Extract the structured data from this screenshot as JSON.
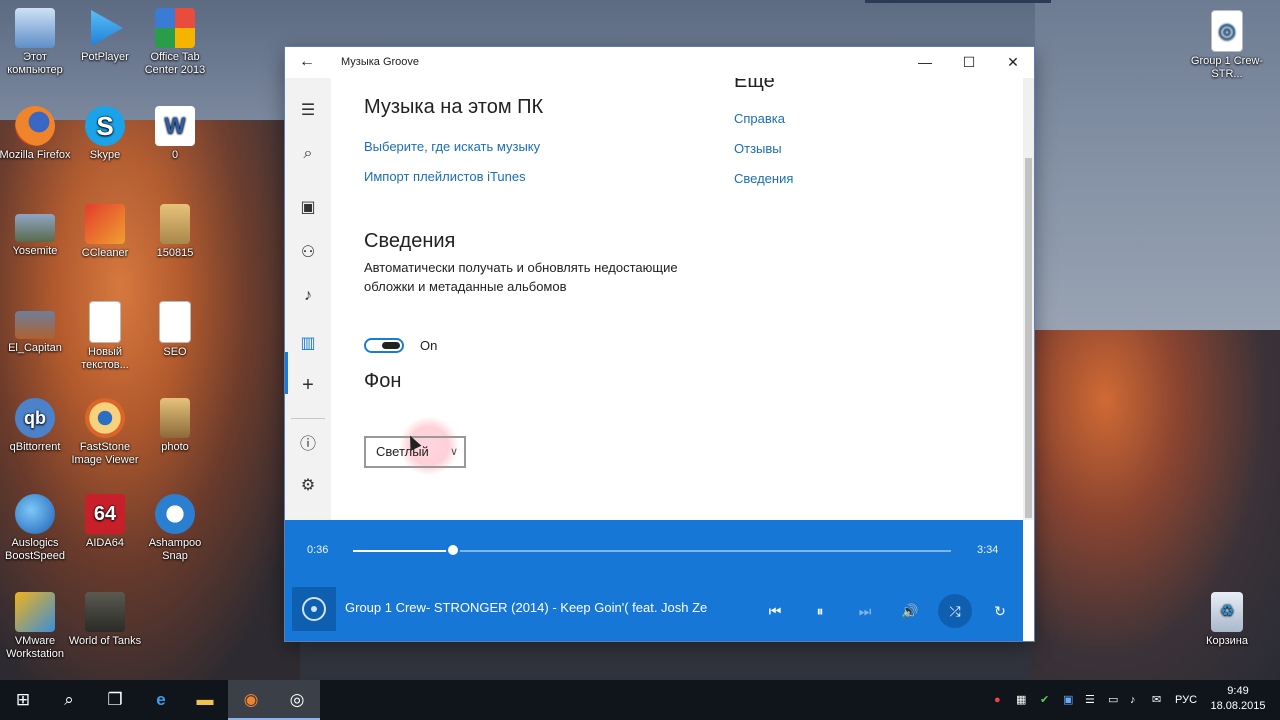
{
  "desktop": {
    "icons": [
      {
        "label": "Этот компьютер",
        "icon": "computer-icon"
      },
      {
        "label": "PotPlayer",
        "icon": "potplayer-icon"
      },
      {
        "label": "Office Tab Center 2013",
        "icon": "office-tab-icon"
      },
      {
        "label": "Mozilla Firefox",
        "icon": "firefox-icon"
      },
      {
        "label": "Skype",
        "icon": "skype-icon"
      },
      {
        "label": "0",
        "icon": "word-doc-icon"
      },
      {
        "label": "Yosemite",
        "icon": "image-icon"
      },
      {
        "label": "CCleaner",
        "icon": "ccleaner-icon"
      },
      {
        "label": "150815",
        "icon": "folder-icon"
      },
      {
        "label": "El_Capitan",
        "icon": "image-icon"
      },
      {
        "label": "Новый текстов...",
        "icon": "text-file-icon"
      },
      {
        "label": "SEO",
        "icon": "text-file-icon"
      },
      {
        "label": "qBittorrent",
        "icon": "qbittorrent-icon"
      },
      {
        "label": "FastStone Image Viewer",
        "icon": "faststone-icon"
      },
      {
        "label": "photo",
        "icon": "folder-icon"
      },
      {
        "label": "Auslogics BoostSpeed",
        "icon": "auslogics-icon"
      },
      {
        "label": "AIDA64",
        "icon": "aida64-icon"
      },
      {
        "label": "Ashampoo Snap",
        "icon": "ashampoo-icon"
      },
      {
        "label": "VMware Workstation",
        "icon": "vmware-icon"
      },
      {
        "label": "World of Tanks",
        "icon": "wot-icon"
      },
      {
        "label": "Group 1 Crew- STR...",
        "icon": "groove-file-icon"
      },
      {
        "label": "Корзина",
        "icon": "recycle-bin-icon"
      }
    ]
  },
  "window": {
    "title": "Музыка Groove",
    "back": "←",
    "minimize": "—",
    "maximize": "☐",
    "close": "✕"
  },
  "rail": {
    "hamburger": "☰",
    "search": "⌕",
    "albums": "▣",
    "artists": "⚇",
    "songs": "♪",
    "now_playing": "▥",
    "add": "+",
    "info": "ⓘ",
    "settings": "⚙"
  },
  "settings": {
    "music_heading": "Музыка на этом ПК",
    "choose_folders": "Выберите, где искать музыку",
    "import_itunes": "Импорт плейлистов iTunes",
    "info_heading": "Сведения",
    "info_desc_1": "Автоматически получать и обновлять недостающие",
    "info_desc_2": "обложки и метаданные альбомов",
    "toggle_state": "On",
    "background_heading": "Фон",
    "background_value": "Светлый",
    "more_heading": "Еще",
    "help": "Справка",
    "feedback": "Отзывы",
    "about": "Сведения"
  },
  "player": {
    "elapsed": "0:36",
    "duration": "3:34",
    "progress": 0.168,
    "song": "Group 1 Crew- STRONGER (2014) - Keep Goin'( feat. Josh Ze",
    "prev": "⏮",
    "pause": "⏸",
    "next": "⏭",
    "volume": "🔊",
    "shuffle": "⤮",
    "repeat": "↻"
  },
  "taskbar": {
    "start": "⊞",
    "search": "⌕",
    "taskview": "❐",
    "edge": "e",
    "explorer": "▬",
    "firefox": "◉",
    "groove": "◎",
    "lang": "РУС",
    "time": "9:49",
    "date": "18.08.2015"
  }
}
